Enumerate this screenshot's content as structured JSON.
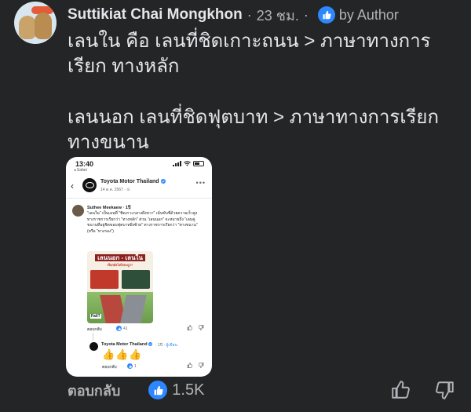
{
  "header": {
    "author_name": "Suttikiat Chai Mongkhon",
    "time_ago": "23 ชม.",
    "author_badge": "by Author"
  },
  "comment": {
    "lines": [
      "เลนใน คือ เลนที่ชิดเกาะถนน > ภาษาทางการ",
      "เรียก ทางหลัก",
      "เลนนอก เลนที่ชิดฟุตบาท > ภาษาทางการเรียก",
      "ทางขนาน"
    ]
  },
  "screenshot": {
    "status_time": "13:40",
    "status_app": "◂ Safari",
    "page_name": "Toyota Motor Thailand",
    "page_date": "14 ต.ค. 2567 · ⊙",
    "commenter_name": "Suthee Meekaew · 1ปี",
    "commenter_text": "\"เลนใน\" เป็นเลนที่ \"ชิดเกาะกลางฝั่งขวา\" เน้นขับขี่ด้วยความเร็วสูง ทางราชการเรียกว่า \"ทางหลัก\" ส่วน \"เลนนอก\" จะหมายถึง \"เลนคู่ขนานที่อยู่ชิดขอบฟุตบาทฝั่งซ้าย\" ทางราชการเรียกว่า \"ทางขนาน\" (หรือ \"ทางรอง\")",
    "infographic_title": "เลนนอก - เลนใน",
    "infographic_subtitle": "เรียกยังไงถึงจะถูก?",
    "infographic_badge": "Fail?",
    "comment_reply": "ตอบกลับ",
    "comment_react_count": "41",
    "reply_name": "Toyota Motor Thailand",
    "reply_meta": "· 1ปี · ",
    "reply_author": "ผู้เขียน",
    "reply_emoji": "👍👍👍",
    "reply_reply": "ตอบกลับ",
    "reply_react_count": "1"
  },
  "footer": {
    "reply_label": "ตอบกลับ",
    "reaction_count": "1.5K"
  },
  "colors": {
    "background": "#242526",
    "text_primary": "#e4e6eb",
    "text_secondary": "#b0b3b8",
    "accent": "#2d88ff"
  }
}
